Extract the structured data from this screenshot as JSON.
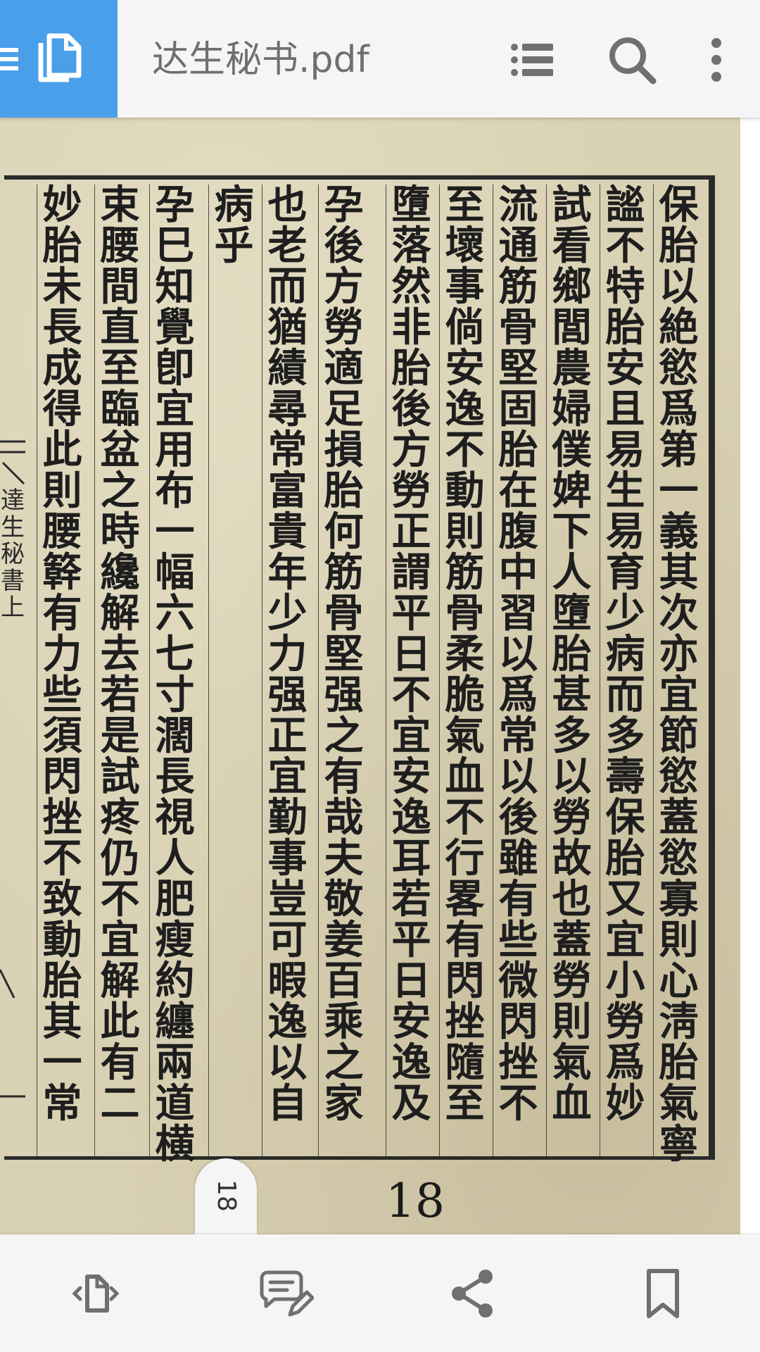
{
  "toolbar": {
    "title": "达生秘书.pdf",
    "icons": [
      "menu-icon",
      "files-icon",
      "toc-icon",
      "search-icon",
      "more-vert-icon"
    ],
    "accent_color": "#4a9fea"
  },
  "document": {
    "columns": [
      "保胎以絶慾爲第一義其次亦宜節慾蓋慾寡則心淸胎氣寧",
      "謐不特胎安且易生易育少病而多壽保胎又宜小勞爲妙",
      "試看鄉閭農婦僕婢下人墮胎甚多以勞故也蓋勞則氣血",
      "流通筋骨堅固胎在腹中習以爲常以後雖有些微閃挫不",
      "至壞事倘安逸不動則筋骨柔脆氣血不行畧有閃挫隨至",
      "墮落然非胎後方勞正謂平日不宜安逸耳若平日安逸及",
      "孕後方勞適足損胎何筋骨堅强之有哉夫敬姜百乘之家",
      "也老而猶績尋常富貴年少力强正宜勤事豈可暇逸以自",
      "病乎",
      "孕巳知覺卽宜用布一幅六七寸濶長視人肥瘦約纏兩道横",
      "束腰間直至臨盆之時纔解去若是試疼仍不宜解此有二",
      "妙胎未長成得此則腰簳有力些須閃挫不致動胎其一常"
    ],
    "margin_text": "達生秘書上",
    "printed_page_number": "18",
    "current_page_tab": "18"
  },
  "bottom_toolbar": {
    "icons": [
      "page-mode-icon",
      "comment-edit-icon",
      "share-icon",
      "bookmark-icon"
    ]
  }
}
